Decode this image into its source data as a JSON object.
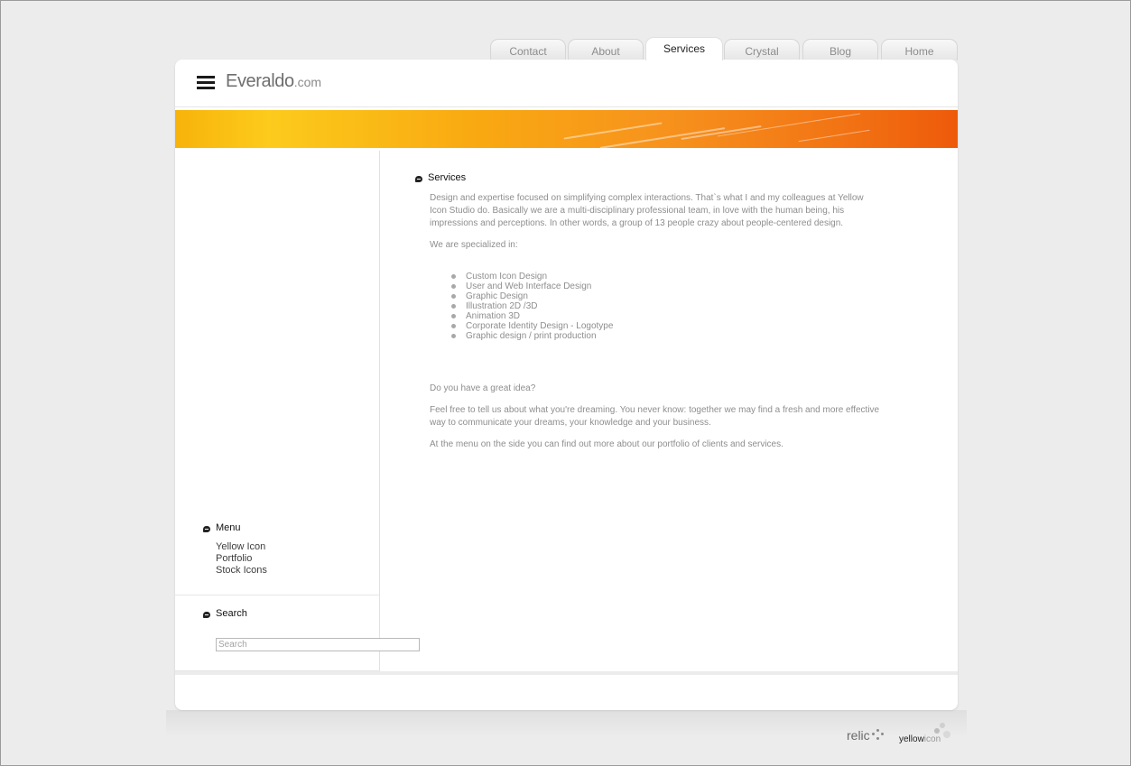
{
  "nav": {
    "tabs": [
      {
        "label": "Contact"
      },
      {
        "label": "About"
      },
      {
        "label": "Services",
        "active": true
      },
      {
        "label": "Crystal"
      },
      {
        "label": "Blog"
      },
      {
        "label": "Home"
      }
    ]
  },
  "header": {
    "logo_main": "Everaldo",
    "logo_suffix": ".com",
    "logo_icon": "hamburger-icon"
  },
  "sidebar": {
    "menu_title": "Menu",
    "menu_items": [
      "Yellow Icon",
      "Portfolio",
      "Stock Icons"
    ],
    "search_title": "Search",
    "search_placeholder": "Search"
  },
  "main": {
    "title": "Services",
    "intro": "Design and expertise focused on simplifying complex interactions. That`s what I and my colleagues at Yellow Icon Studio do. Basically we are a multi-disciplinary professional team, in love with the human being, his impressions and perceptions. In other words, a group of 13 people crazy about people-centered design.",
    "specialized_label": "We are specialized in:",
    "services": [
      "Custom Icon Design",
      "User and Web Interface Design",
      "Graphic Design",
      "Illustration 2D /3D",
      "Animation 3D",
      "Corporate Identity Design - Logotype",
      "Graphic design / print production"
    ],
    "idea_question": "Do you have a great idea?",
    "idea_text": "Feel free to tell us about what you're dreaming. You never know: together we may find a fresh and more effective way to communicate your dreams, your knowledge and your business.",
    "menu_note": "At the menu on the side you can find out more about our portfolio of clients and services."
  },
  "footer": {
    "brand_one": "relic",
    "brand_two_a": "yellow",
    "brand_two_b": "icon"
  },
  "colors": {
    "banner_start": "#f8b30a",
    "banner_end": "#ee5a0a",
    "page_bg": "#ececec"
  }
}
